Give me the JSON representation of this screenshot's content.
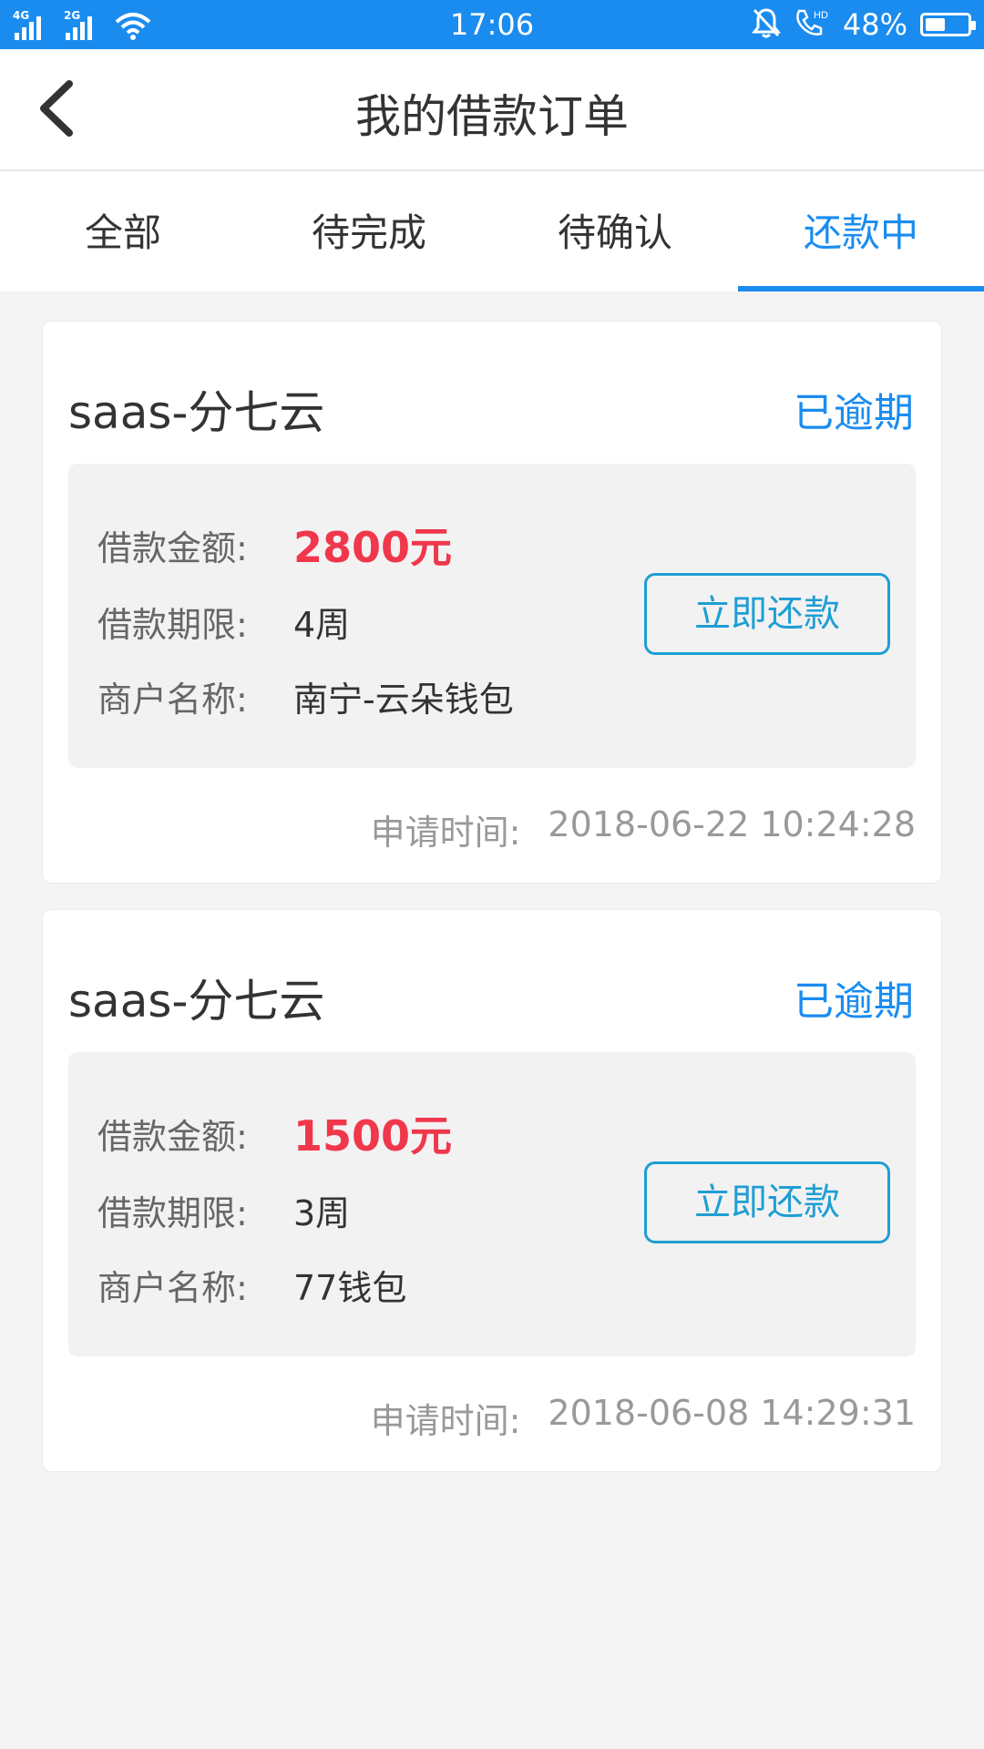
{
  "status_bar": {
    "signal1_tag": "4G",
    "signal2_tag": "2G",
    "time": "17:06",
    "battery_percent": "48%",
    "battery_level": 0.48,
    "icons": [
      "signal-icon",
      "wifi-icon",
      "bell-muted-icon",
      "hd-call-icon",
      "battery-icon"
    ]
  },
  "header": {
    "title": "我的借款订单",
    "back_icon": "chevron-left-icon"
  },
  "tabs": [
    {
      "label": "全部",
      "active": false
    },
    {
      "label": "待完成",
      "active": false
    },
    {
      "label": "待确认",
      "active": false
    },
    {
      "label": "还款中",
      "active": true
    }
  ],
  "orders": [
    {
      "name": "saas-分七云",
      "status": "已逾期",
      "amount_label": "借款金额:",
      "amount": "2800元",
      "term_label": "借款期限:",
      "term": "4周",
      "merchant_label": "商户名称:",
      "merchant": "南宁-云朵钱包",
      "button": "立即还款",
      "apply_label": "申请时间:",
      "apply_time": "2018-06-22 10:24:28"
    },
    {
      "name": "saas-分七云",
      "status": "已逾期",
      "amount_label": "借款金额:",
      "amount": "1500元",
      "term_label": "借款期限:",
      "term": "3周",
      "merchant_label": "商户名称:",
      "merchant": "77钱包",
      "button": "立即还款",
      "apply_label": "申请时间:",
      "apply_time": "2018-06-08 14:29:31"
    }
  ],
  "colors": {
    "accent": "#1a8cf0",
    "amount": "#f0374c",
    "button": "#1f9ed4",
    "background": "#f4f4f4"
  }
}
